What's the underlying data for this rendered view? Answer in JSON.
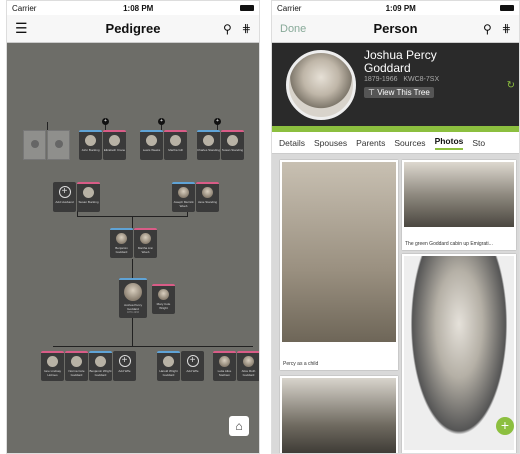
{
  "left": {
    "status": {
      "carrier": "Carrier",
      "time": "1:08 PM"
    },
    "nav": {
      "title": "Pedigree"
    }
  },
  "right": {
    "status": {
      "carrier": "Carrier",
      "time": "1:09 PM"
    },
    "nav": {
      "back": "Done",
      "title": "Person"
    },
    "person": {
      "name": "Joshua Percy Goddard",
      "years": "1879-1966",
      "id": "KWC8-7SX",
      "view_tree": "View This Tree"
    },
    "tabs": [
      "Details",
      "Spouses",
      "Parents",
      "Sources",
      "Photos",
      "Sto"
    ],
    "active_tab": "Photos",
    "photos": {
      "caption_child": "Percy as a child",
      "caption_cabin": "The green Goddard cabin up Emigrati..."
    }
  },
  "tree": {
    "gen4": [
      {
        "name": "John Bucking",
        "years": ""
      },
      {
        "name": "Elizabeth Crane",
        "years": ""
      },
      {
        "name": "Lewis Weeks",
        "years": ""
      },
      {
        "name": "Martha Gill",
        "years": ""
      },
      {
        "name": "Charles Standing",
        "years": ""
      },
      {
        "name": "Susan Standing",
        "years": ""
      }
    ],
    "gen3": [
      {
        "name": "Add Husband",
        "years": ""
      },
      {
        "name": "Susan Bucking",
        "years": ""
      },
      {
        "name": "Joseph Merrick Weeb",
        "years": ""
      },
      {
        "name": "Jane Standing",
        "years": ""
      }
    ],
    "gen2": [
      {
        "name": "Benjamin Goddard",
        "years": ""
      },
      {
        "name": "Martha Ann Weeb",
        "years": ""
      }
    ],
    "focus": [
      {
        "name": "Joshua Percy Goddard",
        "years": "1879-1966"
      },
      {
        "name": "Mary Cole Wright",
        "years": ""
      }
    ],
    "children": [
      {
        "name": "Ione Lindsay Holmes"
      },
      {
        "name": "Norma Cole Goddard"
      },
      {
        "name": "Benjamin Wright Goddard"
      },
      {
        "name": "Add Wife"
      },
      {
        "name": "Harold Wright Goddard"
      },
      {
        "name": "Add Wife"
      },
      {
        "name": "Leita Alice Stetham"
      },
      {
        "name": "Alice Ruth Goddard"
      }
    ]
  },
  "colors": {
    "accent": "#8cbf3f",
    "female": "#d95c87",
    "male": "#5fa3d6"
  }
}
